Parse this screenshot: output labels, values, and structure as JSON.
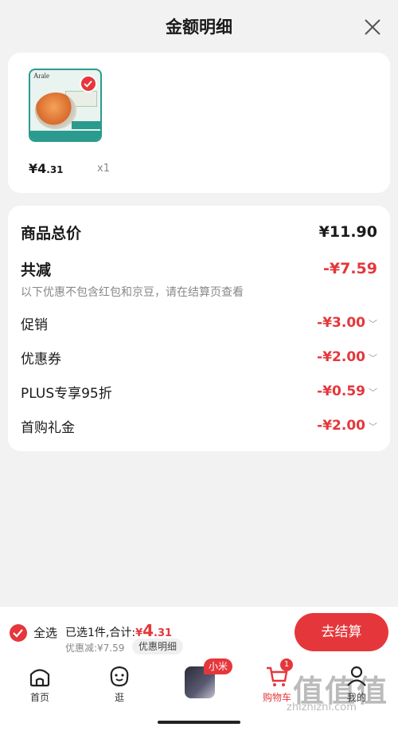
{
  "header": {
    "title": "金额明细"
  },
  "product": {
    "brand": "Arale",
    "price_main": "¥4",
    "price_decimal": ".31",
    "qty": "x1"
  },
  "details": {
    "total_label": "商品总价",
    "total_value": "¥11.90",
    "minus_label": "共减",
    "minus_value": "-¥7.59",
    "note": "以下优惠不包含红包和京豆，请在结算页查看",
    "items": [
      {
        "label": "促销",
        "value": "-¥3.00"
      },
      {
        "label": "优惠券",
        "value": "-¥2.00"
      },
      {
        "label": "PLUS专享95折",
        "value": "-¥0.59"
      },
      {
        "label": "首购礼金",
        "value": "-¥2.00"
      }
    ]
  },
  "bottom_bar": {
    "select_all": "全选",
    "selected_prefix": "已选1件,合计:",
    "amount_symbol": "¥",
    "amount_main": "4",
    "amount_decimal": ".31",
    "discount_text": "优惠减:¥7.59",
    "detail_button": "优惠明细",
    "checkout_button": "去结算"
  },
  "tabs": [
    {
      "label": "首页"
    },
    {
      "label": "逛"
    },
    {
      "label": ""
    },
    {
      "label": "购物车",
      "badge": "1"
    },
    {
      "label": "我的"
    }
  ],
  "promo": {
    "tag": "小米"
  },
  "watermark": {
    "logo": "值值值",
    "text": "zhizhizhi.com"
  },
  "colors": {
    "accent": "#e5373b",
    "teal": "#2a9b8e"
  }
}
